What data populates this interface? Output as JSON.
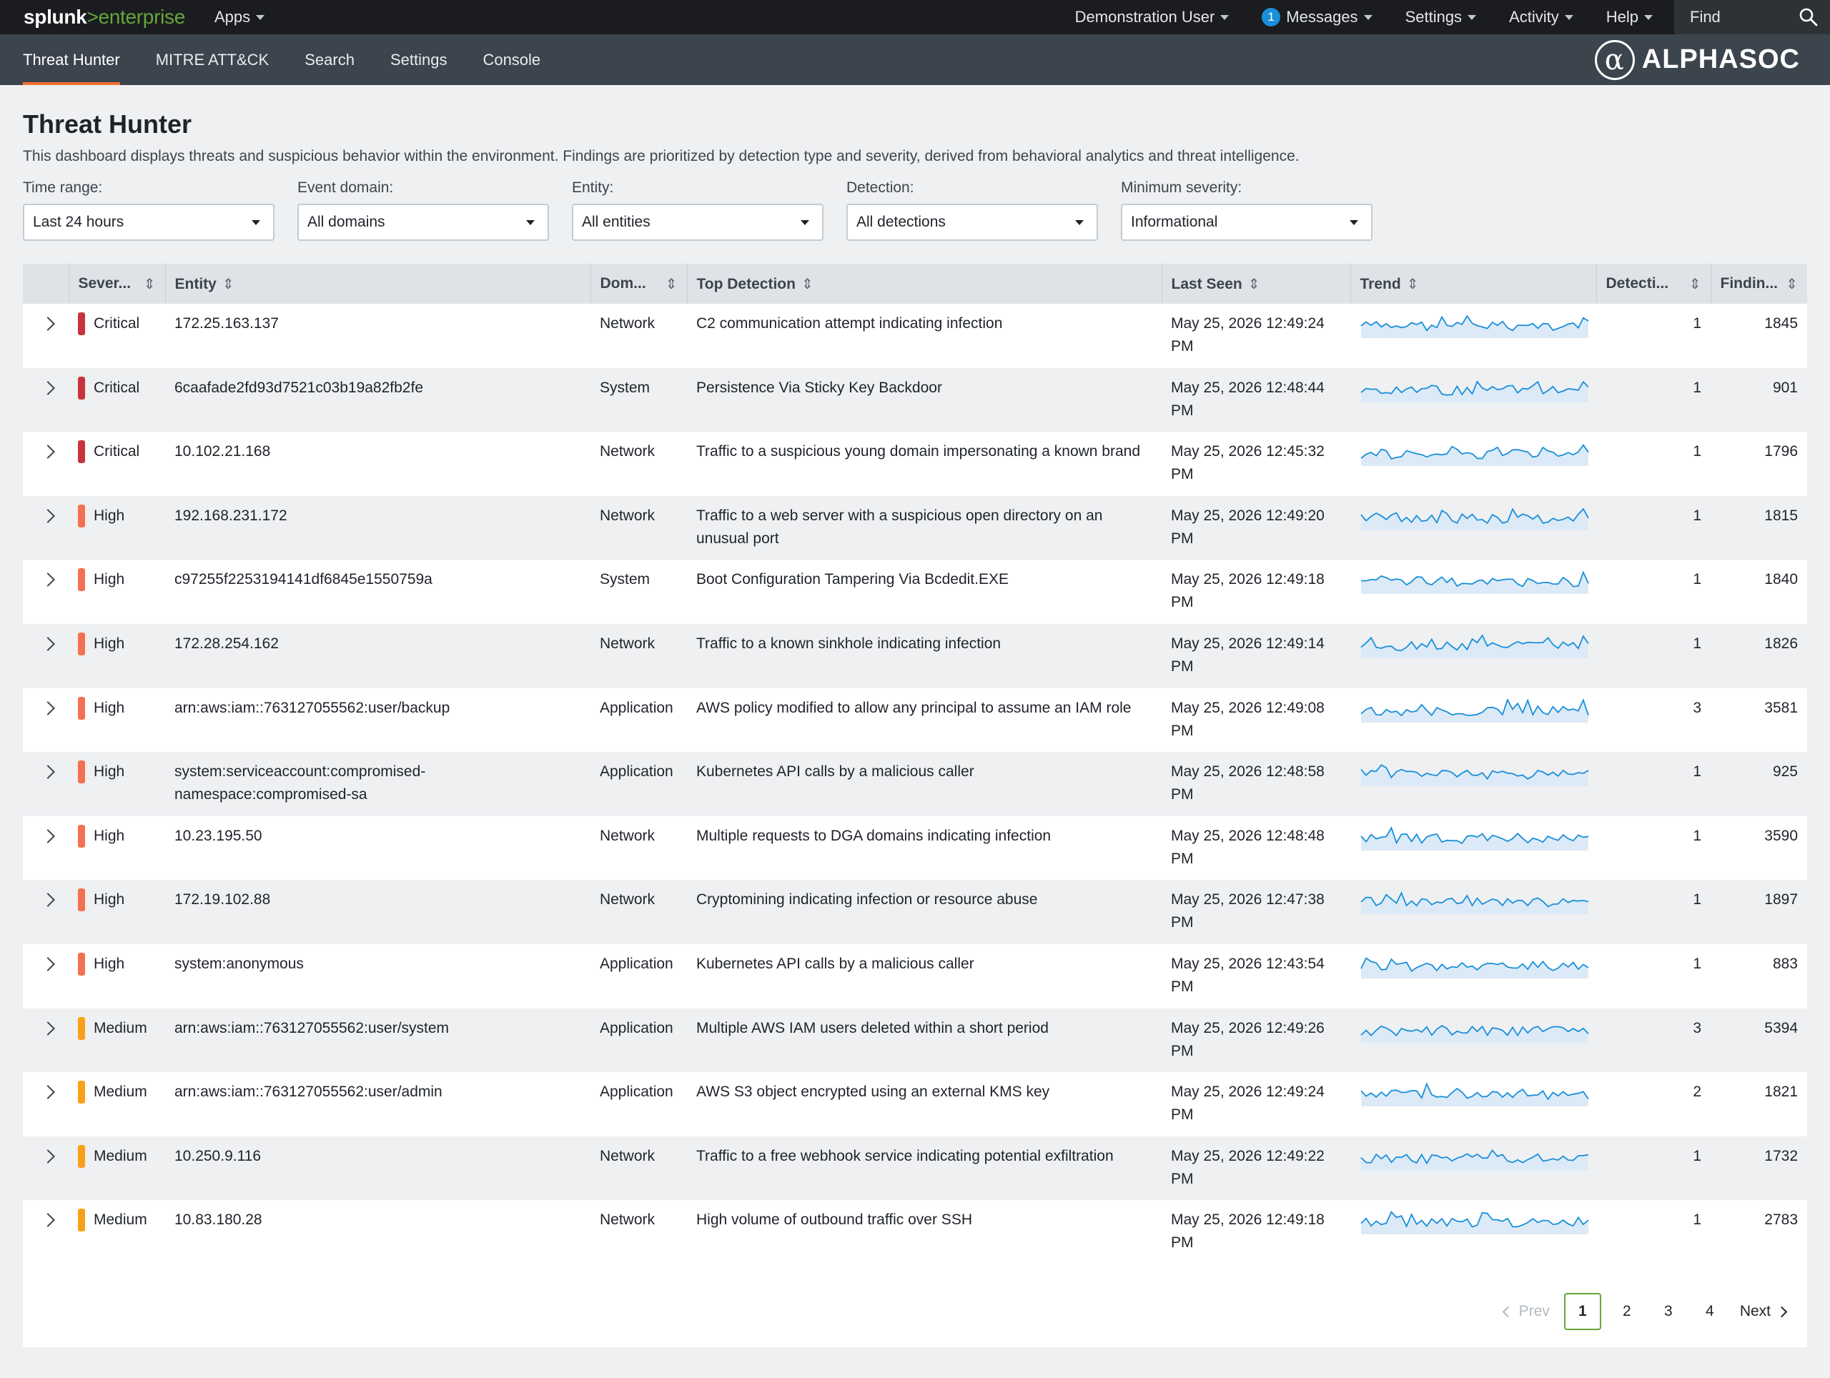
{
  "topbar": {
    "logo_main": "splunk",
    "logo_sub": ">enterprise",
    "apps": "Apps",
    "user": "Demonstration User",
    "messages_count": "1",
    "messages": "Messages",
    "settings": "Settings",
    "activity": "Activity",
    "help": "Help",
    "find": "Find"
  },
  "nav": {
    "tabs": [
      "Threat Hunter",
      "MITRE ATT&CK",
      "Search",
      "Settings",
      "Console"
    ],
    "brand_mark": "α",
    "brand": "ALPHASOC"
  },
  "page": {
    "title": "Threat Hunter",
    "description": "This dashboard displays threats and suspicious behavior within the environment. Findings are prioritized by detection type and severity, derived from behavioral analytics and threat intelligence."
  },
  "filters": [
    {
      "label": "Time range:",
      "value": "Last 24 hours"
    },
    {
      "label": "Event domain:",
      "value": "All domains"
    },
    {
      "label": "Entity:",
      "value": "All entities"
    },
    {
      "label": "Detection:",
      "value": "All detections"
    },
    {
      "label": "Minimum severity:",
      "value": "Informational"
    }
  ],
  "table": {
    "columns": [
      "Sever...",
      "Entity",
      "Dom...",
      "Top Detection",
      "Last Seen",
      "Trend",
      "Detecti...",
      "Findin..."
    ],
    "severity_colors": {
      "Critical": "#c8343b",
      "High": "#f47053",
      "Medium": "#f8a01a"
    },
    "rows": [
      {
        "severity": "Critical",
        "entity": "172.25.163.137",
        "domain": "Network",
        "detection": "C2 communication attempt indicating infection",
        "last_seen": "May 25, 2026 12:49:24 PM",
        "detections": "1",
        "findings": "1845"
      },
      {
        "severity": "Critical",
        "entity": "6caafade2fd93d7521c03b19a82fb2fe",
        "domain": "System",
        "detection": "Persistence Via Sticky Key Backdoor",
        "last_seen": "May 25, 2026 12:48:44 PM",
        "detections": "1",
        "findings": "901"
      },
      {
        "severity": "Critical",
        "entity": "10.102.21.168",
        "domain": "Network",
        "detection": "Traffic to a suspicious young domain impersonating a known brand",
        "last_seen": "May 25, 2026 12:45:32 PM",
        "detections": "1",
        "findings": "1796"
      },
      {
        "severity": "High",
        "entity": "192.168.231.172",
        "domain": "Network",
        "detection": "Traffic to a web server with a suspicious open directory on an unusual port",
        "last_seen": "May 25, 2026 12:49:20 PM",
        "detections": "1",
        "findings": "1815"
      },
      {
        "severity": "High",
        "entity": "c97255f2253194141df6845e1550759a",
        "domain": "System",
        "detection": "Boot Configuration Tampering Via Bcdedit.EXE",
        "last_seen": "May 25, 2026 12:49:18 PM",
        "detections": "1",
        "findings": "1840"
      },
      {
        "severity": "High",
        "entity": "172.28.254.162",
        "domain": "Network",
        "detection": "Traffic to a known sinkhole indicating infection",
        "last_seen": "May 25, 2026 12:49:14 PM",
        "detections": "1",
        "findings": "1826"
      },
      {
        "severity": "High",
        "entity": "arn:aws:iam::763127055562:user/backup",
        "domain": "Application",
        "detection": "AWS policy modified to allow any principal to assume an IAM role",
        "last_seen": "May 25, 2026 12:49:08 PM",
        "detections": "3",
        "findings": "3581"
      },
      {
        "severity": "High",
        "entity": "system:serviceaccount:compromised-namespace:compromised-sa",
        "domain": "Application",
        "detection": "Kubernetes API calls by a malicious caller",
        "last_seen": "May 25, 2026 12:48:58 PM",
        "detections": "1",
        "findings": "925"
      },
      {
        "severity": "High",
        "entity": "10.23.195.50",
        "domain": "Network",
        "detection": "Multiple requests to DGA domains indicating infection",
        "last_seen": "May 25, 2026 12:48:48 PM",
        "detections": "1",
        "findings": "3590"
      },
      {
        "severity": "High",
        "entity": "172.19.102.88",
        "domain": "Network",
        "detection": "Cryptomining indicating infection or resource abuse",
        "last_seen": "May 25, 2026 12:47:38 PM",
        "detections": "1",
        "findings": "1897"
      },
      {
        "severity": "High",
        "entity": "system:anonymous",
        "domain": "Application",
        "detection": "Kubernetes API calls by a malicious caller",
        "last_seen": "May 25, 2026 12:43:54 PM",
        "detections": "1",
        "findings": "883"
      },
      {
        "severity": "Medium",
        "entity": "arn:aws:iam::763127055562:user/system",
        "domain": "Application",
        "detection": "Multiple AWS IAM users deleted within a short period",
        "last_seen": "May 25, 2026 12:49:26 PM",
        "detections": "3",
        "findings": "5394"
      },
      {
        "severity": "Medium",
        "entity": "arn:aws:iam::763127055562:user/admin",
        "domain": "Application",
        "detection": "AWS S3 object encrypted using an external KMS key",
        "last_seen": "May 25, 2026 12:49:24 PM",
        "detections": "2",
        "findings": "1821"
      },
      {
        "severity": "Medium",
        "entity": "10.250.9.116",
        "domain": "Network",
        "detection": "Traffic to a free webhook service indicating potential exfiltration",
        "last_seen": "May 25, 2026 12:49:22 PM",
        "detections": "1",
        "findings": "1732"
      },
      {
        "severity": "Medium",
        "entity": "10.83.180.28",
        "domain": "Network",
        "detection": "High volume of outbound traffic over SSH",
        "last_seen": "May 25, 2026 12:49:18 PM",
        "detections": "1",
        "findings": "2783"
      }
    ]
  },
  "pagination": {
    "prev": "Prev",
    "pages": [
      "1",
      "2",
      "3",
      "4"
    ],
    "current": "1",
    "next": "Next"
  },
  "colors": {
    "trend_line": "#1a8fd9",
    "trend_fill": "#dceaf7",
    "accent_tab": "#f2722d",
    "pager_current": "#65a637"
  }
}
